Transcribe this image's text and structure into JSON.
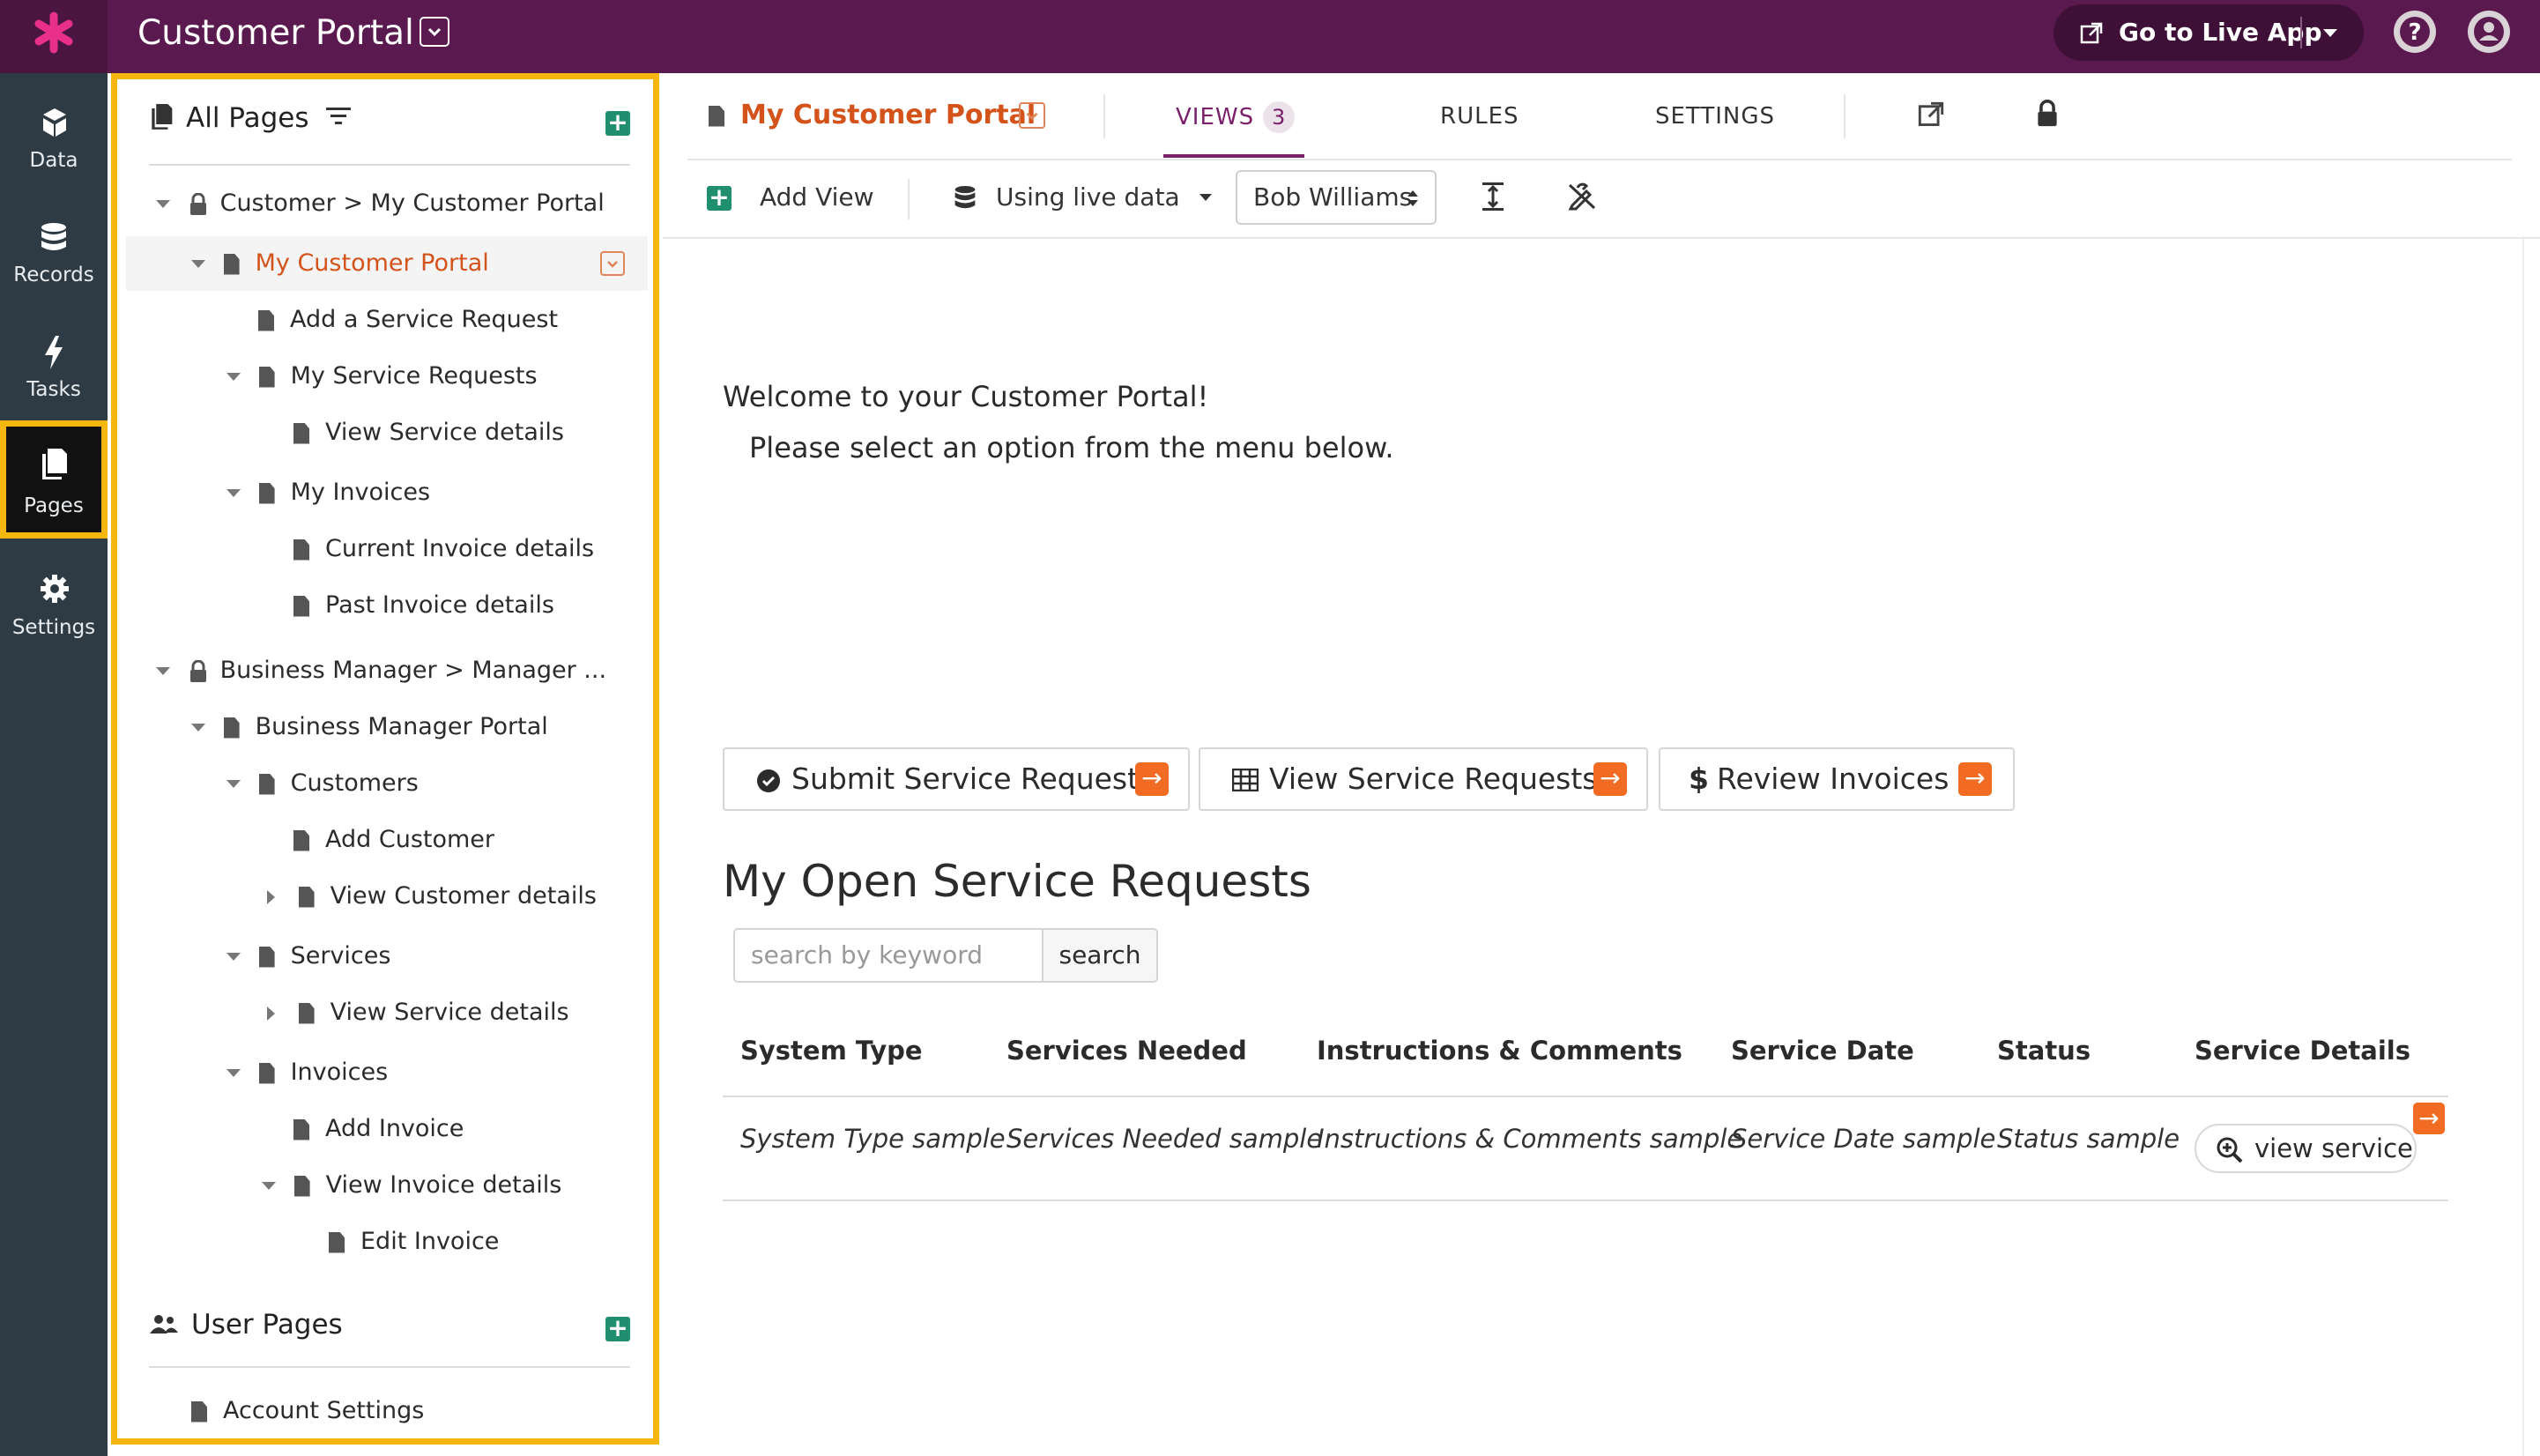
{
  "header": {
    "app_title": "Customer Portal",
    "go_live_label": "Go to Live App"
  },
  "leftnav": {
    "items": [
      {
        "label": "Data",
        "icon": "data-icon"
      },
      {
        "label": "Records",
        "icon": "database-icon"
      },
      {
        "label": "Tasks",
        "icon": "bolt-icon"
      },
      {
        "label": "Pages",
        "icon": "pages-icon",
        "active": true
      },
      {
        "label": "Settings",
        "icon": "gear-icon"
      }
    ]
  },
  "pages_panel": {
    "all_pages_title": "All Pages",
    "tree": [
      {
        "label": "Customer > My Customer Portal",
        "icon": "lock-icon"
      },
      {
        "label": "My Customer Portal",
        "selected": true
      },
      {
        "label": "Add a Service Request"
      },
      {
        "label": "My Service Requests"
      },
      {
        "label": "View Service details"
      },
      {
        "label": "My Invoices"
      },
      {
        "label": "Current Invoice details"
      },
      {
        "label": "Past Invoice details"
      },
      {
        "label": "Business Manager > Manager ...",
        "icon": "lock-icon"
      },
      {
        "label": "Business Manager Portal"
      },
      {
        "label": "Customers"
      },
      {
        "label": "Add Customer"
      },
      {
        "label": "View Customer details"
      },
      {
        "label": "Services"
      },
      {
        "label": "View Service details"
      },
      {
        "label": "Invoices"
      },
      {
        "label": "Add Invoice"
      },
      {
        "label": "View Invoice details"
      },
      {
        "label": "Edit Invoice"
      }
    ],
    "user_pages_title": "User Pages",
    "user_pages": [
      {
        "label": "Account Settings"
      }
    ]
  },
  "main": {
    "page_name": "My Customer Portal",
    "tabs": [
      {
        "label": "VIEWS",
        "count": "3",
        "active": true
      },
      {
        "label": "RULES"
      },
      {
        "label": "SETTINGS"
      }
    ],
    "toolbar": {
      "add_view_label": "Add View",
      "data_mode_label": "Using live data",
      "user_select_value": "Bob Williams"
    },
    "welcome_line1": "Welcome to your Customer Portal!",
    "welcome_line2": "Please select an option from the menu below.",
    "action_buttons": [
      {
        "label": "Submit Service Request",
        "icon": "check-circle-icon"
      },
      {
        "label": "View Service Requests",
        "icon": "table-icon"
      },
      {
        "label": "Review Invoices",
        "icon": "dollar-icon"
      }
    ],
    "section_title": "My Open Service Requests",
    "search": {
      "placeholder": "search by keyword",
      "button_label": "search"
    },
    "table": {
      "columns": [
        "System Type",
        "Services Needed",
        "Instructions & Comments",
        "Service Date",
        "Status",
        "Service Details"
      ],
      "rows": [
        {
          "cells": [
            "System Type sample",
            "Services Needed sample",
            "Instructions & Comments sample",
            "Service Date sample",
            "Status sample"
          ],
          "link_label": "view service"
        }
      ]
    }
  },
  "colors": {
    "header_bg": "#5b1a4f",
    "nav_bg": "#2e3b44",
    "highlight": "#f5b70f",
    "accent_orange": "#f26b22",
    "selected_text": "#d4531a",
    "tab_active": "#7a1f6a",
    "add_green": "#1f8f6f"
  }
}
